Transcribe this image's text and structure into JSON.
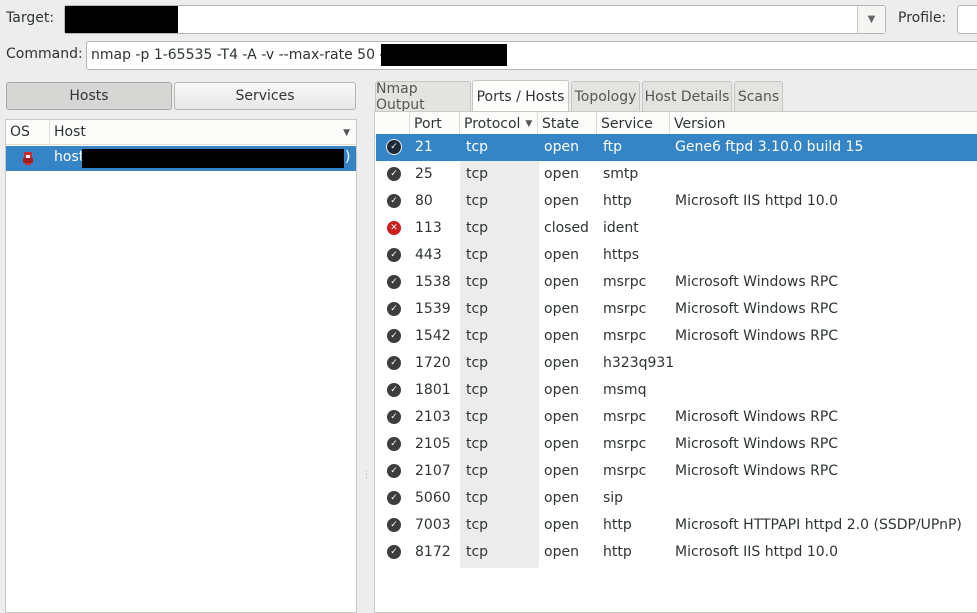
{
  "toolbar": {
    "target_label": "Target:",
    "profile_label": "Profile:",
    "command_label": "Command:",
    "command_value": "nmap -p 1-65535 -T4 -A -v --max-rate 50 -Pn"
  },
  "left": {
    "hosts_button": "Hosts",
    "services_button": "Services",
    "col_os": "OS",
    "col_host": "Host",
    "host_row_prefix": "host",
    "host_row_suffix": ")"
  },
  "tabs": [
    "Nmap Output",
    "Ports / Hosts",
    "Topology",
    "Host Details",
    "Scans"
  ],
  "ports_table": {
    "columns": [
      "Port",
      "Protocol",
      "State",
      "Service",
      "Version"
    ],
    "rows": [
      {
        "port": "21",
        "protocol": "tcp",
        "state": "open",
        "service": "ftp",
        "version": "Gene6 ftpd 3.10.0 build 15"
      },
      {
        "port": "25",
        "protocol": "tcp",
        "state": "open",
        "service": "smtp",
        "version": ""
      },
      {
        "port": "80",
        "protocol": "tcp",
        "state": "open",
        "service": "http",
        "version": "Microsoft IIS httpd 10.0"
      },
      {
        "port": "113",
        "protocol": "tcp",
        "state": "closed",
        "service": "ident",
        "version": ""
      },
      {
        "port": "443",
        "protocol": "tcp",
        "state": "open",
        "service": "https",
        "version": ""
      },
      {
        "port": "1538",
        "protocol": "tcp",
        "state": "open",
        "service": "msrpc",
        "version": "Microsoft Windows RPC"
      },
      {
        "port": "1539",
        "protocol": "tcp",
        "state": "open",
        "service": "msrpc",
        "version": "Microsoft Windows RPC"
      },
      {
        "port": "1542",
        "protocol": "tcp",
        "state": "open",
        "service": "msrpc",
        "version": "Microsoft Windows RPC"
      },
      {
        "port": "1720",
        "protocol": "tcp",
        "state": "open",
        "service": "h323q931",
        "version": ""
      },
      {
        "port": "1801",
        "protocol": "tcp",
        "state": "open",
        "service": "msmq",
        "version": ""
      },
      {
        "port": "2103",
        "protocol": "tcp",
        "state": "open",
        "service": "msrpc",
        "version": "Microsoft Windows RPC"
      },
      {
        "port": "2105",
        "protocol": "tcp",
        "state": "open",
        "service": "msrpc",
        "version": "Microsoft Windows RPC"
      },
      {
        "port": "2107",
        "protocol": "tcp",
        "state": "open",
        "service": "msrpc",
        "version": "Microsoft Windows RPC"
      },
      {
        "port": "5060",
        "protocol": "tcp",
        "state": "open",
        "service": "sip",
        "version": ""
      },
      {
        "port": "7003",
        "protocol": "tcp",
        "state": "open",
        "service": "http",
        "version": "Microsoft HTTPAPI httpd 2.0 (SSDP/UPnP)"
      },
      {
        "port": "8172",
        "protocol": "tcp",
        "state": "open",
        "service": "http",
        "version": "Microsoft IIS httpd 10.0"
      }
    ]
  },
  "colors": {
    "selection": "#3585c6",
    "open_icon": "#3d3d3d",
    "closed_icon": "#cc1f1f"
  }
}
